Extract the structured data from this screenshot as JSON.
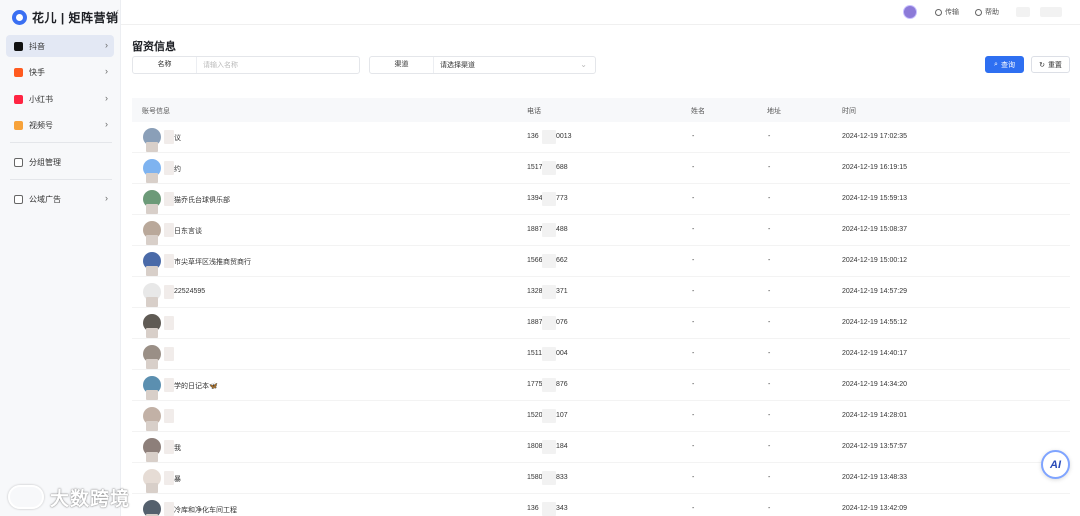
{
  "app": {
    "brand": "花儿 | 矩阵营销",
    "collapse_glyph": "‹"
  },
  "sidebar": {
    "items": [
      {
        "label": "抖音",
        "icon": "douyin-icon",
        "active": true
      },
      {
        "label": "快手",
        "icon": "kuaishou-icon",
        "active": false
      },
      {
        "label": "小红书",
        "icon": "xiaohongshu-icon",
        "active": false
      },
      {
        "label": "视频号",
        "icon": "video-account-icon",
        "active": false
      },
      {
        "label": "分组管理",
        "icon": "group-icon",
        "active": false
      },
      {
        "label": "公域广告",
        "icon": "ad-icon",
        "active": false
      }
    ]
  },
  "header": {
    "links": [
      {
        "label": "传输",
        "icon": "transfer-icon"
      },
      {
        "label": "帮助",
        "icon": "help-icon"
      }
    ]
  },
  "page": {
    "title": "留资信息"
  },
  "filters": {
    "name_label": "名称",
    "name_placeholder": "请输入名称",
    "channel_label": "渠道",
    "channel_value": "请选择渠道",
    "search_label": "查询",
    "reset_label": "重置"
  },
  "table": {
    "columns": [
      "账号信息",
      "电话",
      "姓名",
      "地址",
      "时间"
    ],
    "rows": [
      {
        "account": "议",
        "phone_start": "136",
        "phone_end": "0013",
        "name": "-",
        "addr": "-",
        "time": "2024-12-19 17:02:35"
      },
      {
        "account": "约",
        "phone_start": "1517",
        "phone_end": "688",
        "name": "-",
        "addr": "-",
        "time": "2024-12-19 16:19:15"
      },
      {
        "account": "猫乔氏台球俱乐部",
        "phone_start": "1394",
        "phone_end": "773",
        "name": "-",
        "addr": "-",
        "time": "2024-12-19 15:59:13"
      },
      {
        "account": "日东言谈",
        "phone_start": "1887",
        "phone_end": "488",
        "name": "-",
        "addr": "-",
        "time": "2024-12-19 15:08:37"
      },
      {
        "account": "市尖草坪区浅推商贸商行",
        "phone_start": "1566",
        "phone_end": "662",
        "name": "-",
        "addr": "-",
        "time": "2024-12-19 15:00:12"
      },
      {
        "account": "22524595",
        "phone_start": "1328",
        "phone_end": "371",
        "name": "-",
        "addr": "-",
        "time": "2024-12-19 14:57:29"
      },
      {
        "account": "",
        "phone_start": "1887",
        "phone_end": "076",
        "name": "-",
        "addr": "-",
        "time": "2024-12-19 14:55:12"
      },
      {
        "account": "",
        "phone_start": "1511",
        "phone_end": "004",
        "name": "-",
        "addr": "-",
        "time": "2024-12-19 14:40:17"
      },
      {
        "account": "学的日记本🦋",
        "phone_start": "1775",
        "phone_end": "876",
        "name": "-",
        "addr": "-",
        "time": "2024-12-19 14:34:20"
      },
      {
        "account": "",
        "phone_start": "1520",
        "phone_end": "107",
        "name": "-",
        "addr": "-",
        "time": "2024-12-19 14:28:01"
      },
      {
        "account": "我",
        "phone_start": "1808",
        "phone_end": "184",
        "name": "-",
        "addr": "-",
        "time": "2024-12-19 13:57:57"
      },
      {
        "account": "暴",
        "phone_start": "1580",
        "phone_end": "833",
        "name": "-",
        "addr": "-",
        "time": "2024-12-19 13:48:33"
      },
      {
        "account": "冷库和净化车间工程",
        "phone_start": "136",
        "phone_end": "343",
        "name": "-",
        "addr": "-",
        "time": "2024-12-19 13:42:09"
      }
    ]
  },
  "floating": {
    "ai_label": "AI"
  },
  "watermark": {
    "text": "大数跨境"
  },
  "colors": {
    "primary": "#2e6ff1",
    "sidebar_bg": "#f7f8fa",
    "active_bg": "#e3e8f4"
  }
}
